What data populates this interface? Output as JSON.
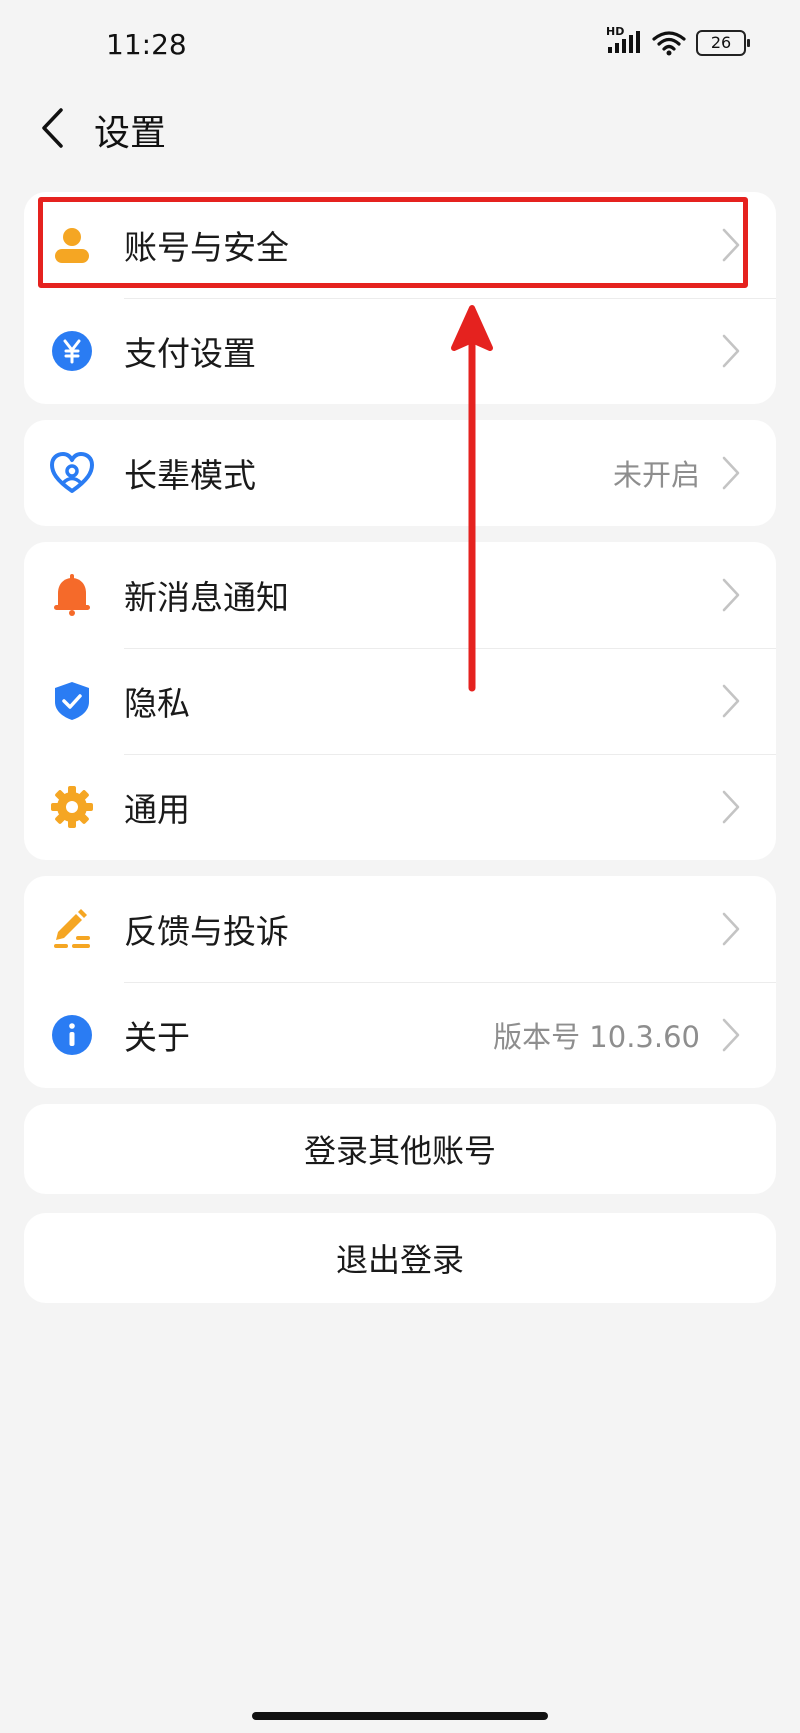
{
  "status_bar": {
    "time": "11:28",
    "network": "HD",
    "battery": "26"
  },
  "header": {
    "title": "设置"
  },
  "sections": [
    {
      "items": [
        {
          "label": "账号与安全",
          "icon": "user-icon"
        },
        {
          "label": "支付设置",
          "icon": "yuan-icon"
        }
      ]
    },
    {
      "items": [
        {
          "label": "长辈模式",
          "icon": "heart-icon",
          "value": "未开启"
        }
      ]
    },
    {
      "items": [
        {
          "label": "新消息通知",
          "icon": "bell-icon"
        },
        {
          "label": "隐私",
          "icon": "shield-icon"
        },
        {
          "label": "通用",
          "icon": "gear-icon"
        }
      ]
    },
    {
      "items": [
        {
          "label": "反馈与投诉",
          "icon": "pencil-icon"
        },
        {
          "label": "关于",
          "icon": "info-icon",
          "value": "版本号 10.3.60"
        }
      ]
    }
  ],
  "buttons": {
    "switch_account": "登录其他账号",
    "logout": "退出登录"
  },
  "colors": {
    "highlight": "#e5221f",
    "accent_blue": "#2a7cf3",
    "accent_orange": "#f5a623",
    "bell_orange": "#f56a2a"
  }
}
